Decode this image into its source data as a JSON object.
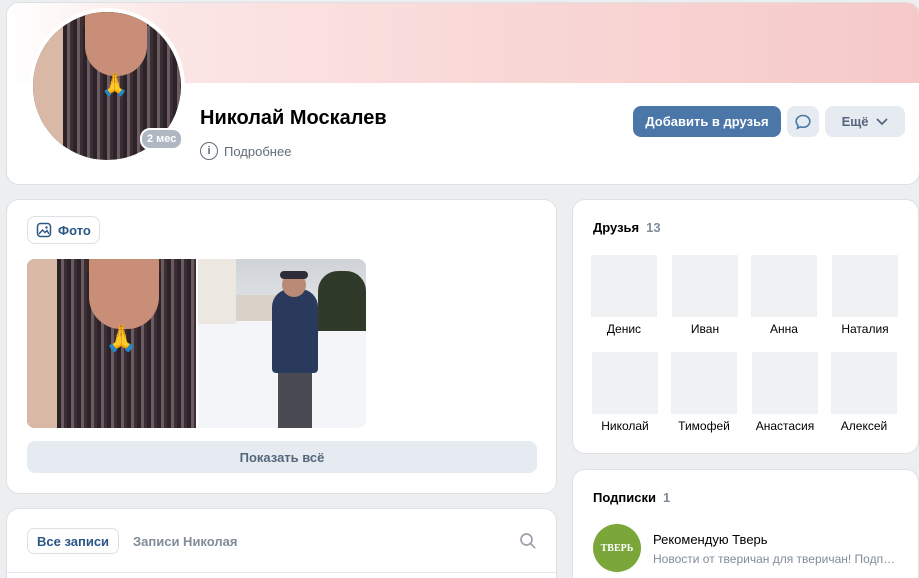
{
  "profile": {
    "name": "Николай Москалев",
    "online_badge": "2 мес",
    "details_label": "Подробнее",
    "avatar_emoji": "🙏"
  },
  "actions": {
    "add_friend_label": "Добавить в друзья",
    "more_label": "Ещё"
  },
  "photos": {
    "chip_label": "Фото",
    "show_all_label": "Показать всё",
    "photo_emoji": "🙏"
  },
  "posts": {
    "tab_all_label": "Все записи",
    "tab_user_label": "Записи Николая"
  },
  "friends": {
    "title": "Друзья",
    "count": "13",
    "items": [
      {
        "name": "Денис"
      },
      {
        "name": "Иван"
      },
      {
        "name": "Анна"
      },
      {
        "name": "Наталия"
      },
      {
        "name": "Николай"
      },
      {
        "name": "Тимофей"
      },
      {
        "name": "Анастасия"
      },
      {
        "name": "Алексей"
      }
    ]
  },
  "subscriptions": {
    "title": "Подписки",
    "count": "1",
    "items": [
      {
        "name": "Рекомендую Тверь",
        "description": "Новости от тверичан для тверичан! Подписывайтесь",
        "logo_text": "ТВЕРЬ"
      }
    ]
  },
  "colors": {
    "accent": "#4a76a8",
    "link": "#2a5885",
    "secondary_button": "#e5ebf1"
  }
}
